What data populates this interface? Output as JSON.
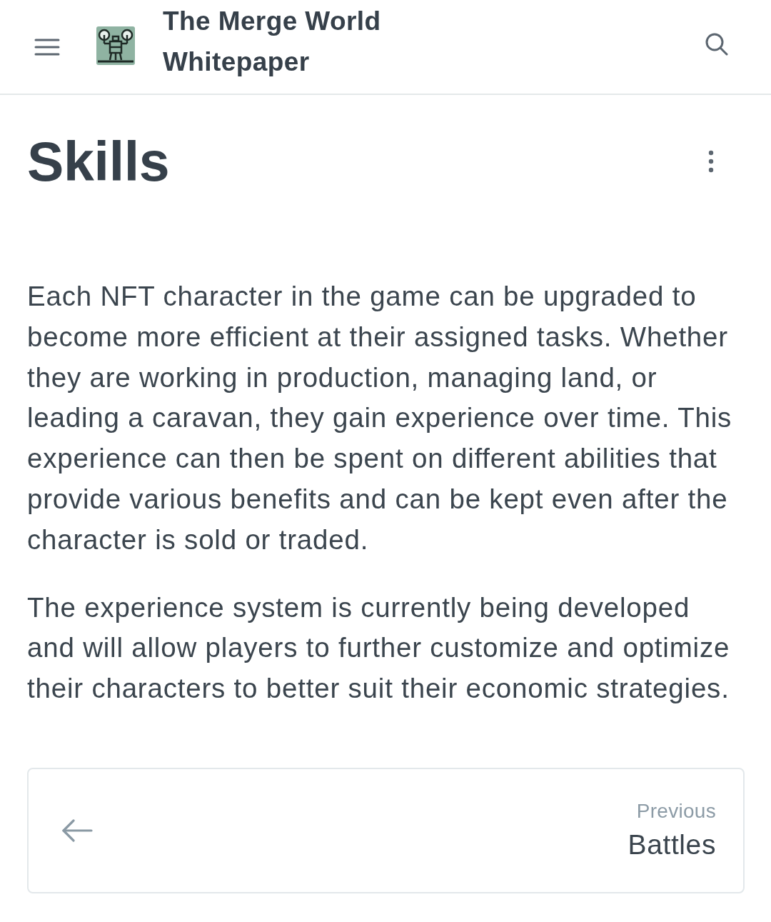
{
  "header": {
    "title": "The Merge World Whitepaper"
  },
  "page": {
    "title": "Skills",
    "paragraphs": [
      "Each NFT character in the game can be upgraded to become more efficient at their assigned tasks. Whether they are working in production, managing land, or leading a caravan, they gain experience over time. This experience can then be spent on different abilities that provide various benefits and can be kept even after the character is sold or traded.",
      "The experience system is currently being developed and will allow players to further customize and optimize their characters to better suit their economic strategies."
    ]
  },
  "pagination": {
    "previous": {
      "label": "Previous",
      "title": "Battles"
    }
  }
}
